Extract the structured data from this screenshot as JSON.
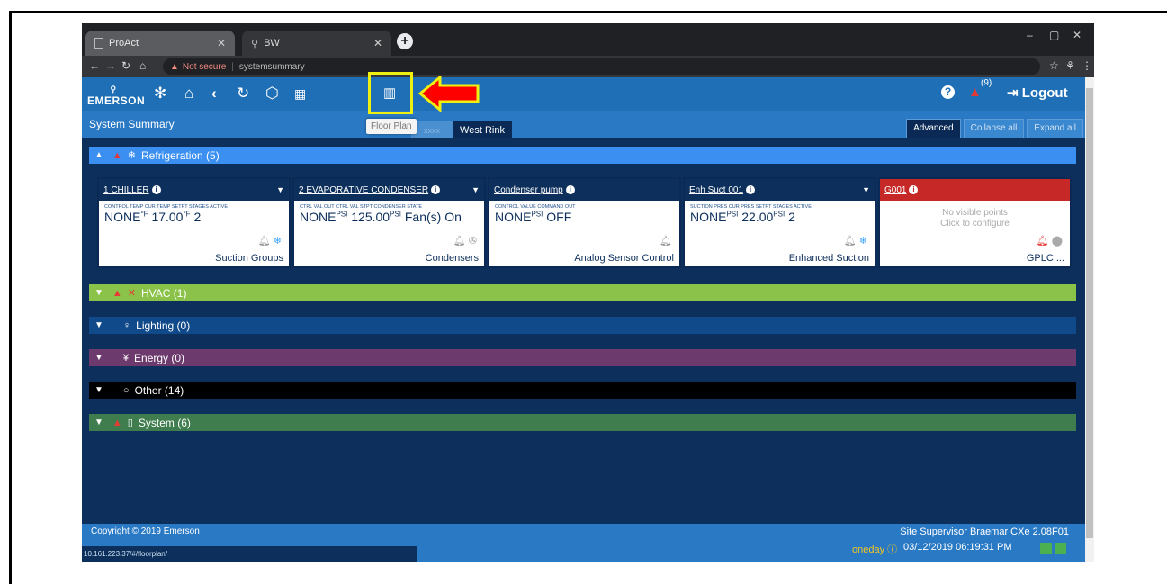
{
  "browser": {
    "tabs": [
      {
        "title": "ProAct"
      },
      {
        "title": "BW"
      }
    ],
    "address": {
      "warning": "Not secure",
      "url": "systemsummary"
    }
  },
  "header": {
    "logo": "EMERSON",
    "alarm_count": "(9)",
    "logout": "Logout",
    "floor_plan_tooltip": "Floor Plan"
  },
  "titlebar": {
    "title": "System Summary",
    "tabs": [
      "xxxx",
      "West Rink"
    ],
    "buttons": [
      "Advanced",
      "Collapse all",
      "Expand all"
    ]
  },
  "sections": [
    {
      "label": "Refrigeration (5)",
      "color": "#3a8ff0"
    },
    {
      "label": "HVAC (1)",
      "color": "#8bc34a"
    },
    {
      "label": "Lighting (0)",
      "color": "#114a8a"
    },
    {
      "label": "Energy (0)",
      "color": "#6d3a6d"
    },
    {
      "label": "Other (14)",
      "color": "#000000"
    },
    {
      "label": "System (6)",
      "color": "#3f7d4e"
    }
  ],
  "cards": [
    {
      "title": "1 CHILLER",
      "labels": "CONTROL TEMP   CUR TEMP SETPT   STAGES ACTIVE",
      "v1": "NONE",
      "u1": "°F",
      "v2": "17.00",
      "u2": "°F",
      "v3": "2",
      "foot": "Suction Groups"
    },
    {
      "title": "2 EVAPORATIVE CONDENSER",
      "labels": "CTRL VAL OUT     CTRL VAL STPT     CONDENSER STATE",
      "v1": "NONE",
      "u1": "PSI",
      "v2": "125.00",
      "u2": "PSI",
      "v3": "Fan(s) On",
      "foot": "Condensers"
    },
    {
      "title": "Condenser pump",
      "labels": "CONTROL VALUE   COMMAND OUT",
      "v1": "NONE",
      "u1": "PSI",
      "v2": "OFF",
      "u2": "",
      "v3": "",
      "foot": "Analog Sensor Control"
    },
    {
      "title": "Enh Suct 001",
      "labels": "SUCTION PRES     CUR PRES SETPT   STAGES ACTIVE",
      "v1": "NONE",
      "u1": "PSI",
      "v2": "22.00",
      "u2": "PSI",
      "v3": "2",
      "foot": "Enhanced Suction"
    },
    {
      "title": "G001",
      "no_points_1": "No visible points",
      "no_points_2": "Click to configure",
      "foot": "GPLC ..."
    }
  ],
  "footer": {
    "copyright": "Copyright © 2019 Emerson",
    "status_url": "10.161.223.37/#/floorplan/",
    "site": "Site Supervisor Braemar CXe 2.08F01",
    "oneday": "oneday",
    "datetime": "03/12/2019 06:19:31 PM"
  }
}
